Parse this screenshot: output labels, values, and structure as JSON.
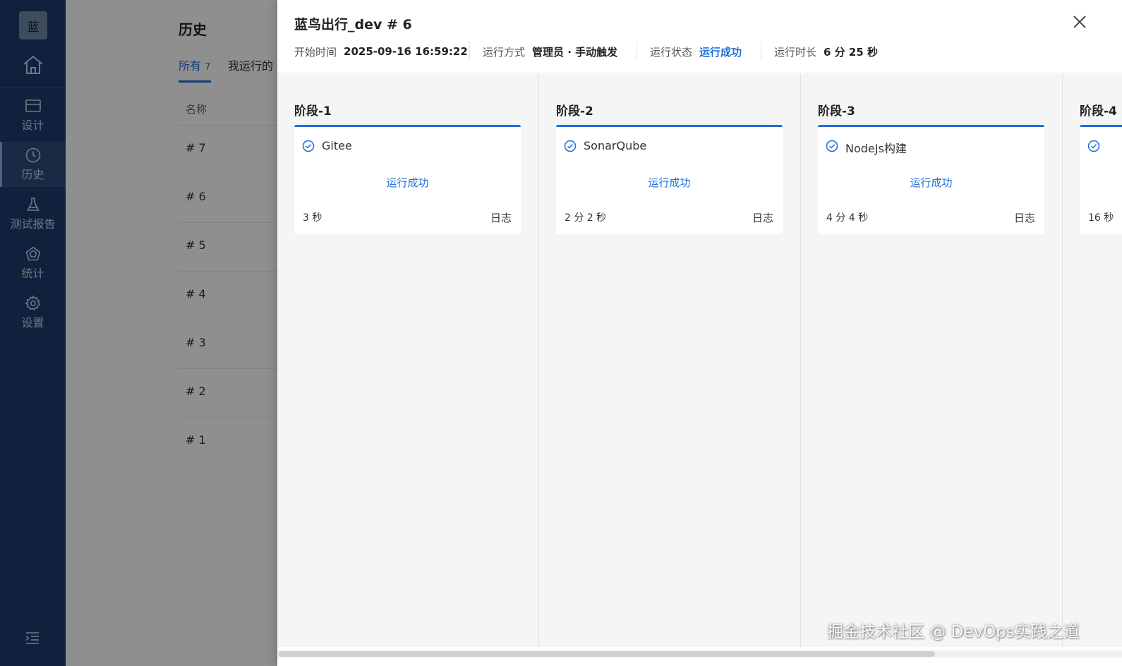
{
  "sidebar": {
    "logo": "蓝",
    "nav": [
      {
        "label": "设计",
        "icon": "design-icon"
      },
      {
        "label": "历史",
        "icon": "clock-icon"
      },
      {
        "label": "测试报告",
        "icon": "flask-icon"
      },
      {
        "label": "统计",
        "icon": "pentagon-chart-icon"
      },
      {
        "label": "设置",
        "icon": "gear-icon"
      }
    ],
    "active": "历史"
  },
  "background_page": {
    "title": "历史",
    "tabs": [
      {
        "label": "所有",
        "count": "7"
      },
      {
        "label": "我运行的"
      }
    ],
    "column_name": "名称",
    "rows": [
      "# 7",
      "# 6",
      "# 5",
      "# 4",
      "# 3",
      "# 2",
      "# 1"
    ]
  },
  "drawer": {
    "title": "蓝鸟出行_dev # 6",
    "meta": {
      "start_time_label": "开始时间",
      "start_time": "2025-09-16 16:59:22",
      "run_mode_label": "运行方式",
      "run_mode": "管理员 · 手动触发",
      "status_label": "运行状态",
      "status": "运行成功",
      "duration_label": "运行时长",
      "duration": "6 分 25 秒"
    },
    "stages": [
      {
        "title": "阶段-1",
        "job": {
          "name": "Gitee",
          "status": "运行成功",
          "duration": "3 秒",
          "log": "日志"
        }
      },
      {
        "title": "阶段-2",
        "job": {
          "name": "SonarQube",
          "status": "运行成功",
          "duration": "2 分 2 秒",
          "log": "日志"
        }
      },
      {
        "title": "阶段-3",
        "job": {
          "name": "NodeJs构建",
          "status": "运行成功",
          "duration": "4 分 4 秒",
          "log": "日志"
        }
      },
      {
        "title": "阶段-4",
        "job": {
          "name": "",
          "status": "",
          "duration": "16 秒",
          "log": ""
        }
      }
    ]
  },
  "watermark": "掘金技术社区 @ DevOps实践之道",
  "colors": {
    "sidebar_bg": "#1e3a6e",
    "accent": "#1e6fd9",
    "stage_bg": "#f5f5f5"
  }
}
